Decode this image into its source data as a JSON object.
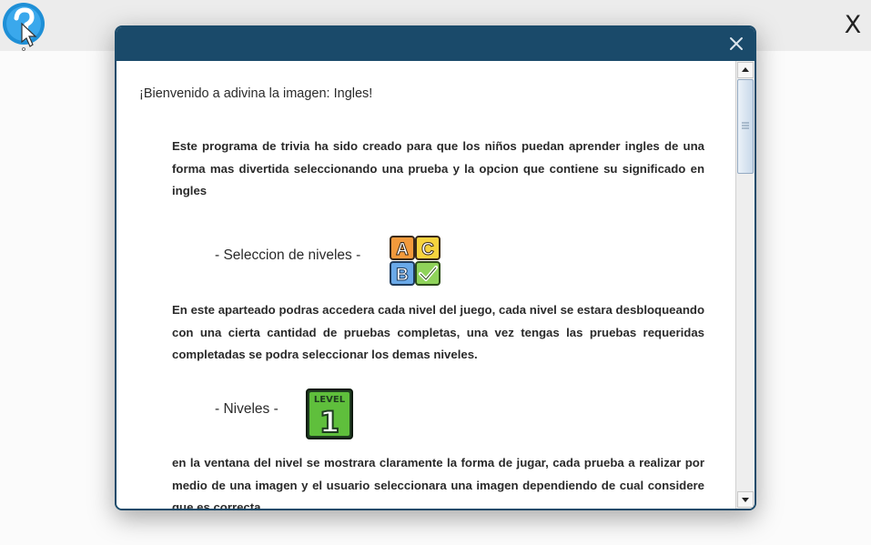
{
  "app": {
    "close_label": "X",
    "help_icon": "question-mark-cursor-icon"
  },
  "dialog": {
    "header_color": "#1a4a6a",
    "close_icon": "close-icon",
    "welcome_text": "¡Bienvenido a adivina la imagen: Ingles!",
    "intro_text": "Este programa de trivia ha sido creado para que los niños puedan aprender ingles de una forma mas divertida seleccionando una prueba y la opcion que contiene su significado en ingles",
    "sections": [
      {
        "label": "- Seleccion de niveles -",
        "icon": "abc-checkmark-icon",
        "icon_letters": [
          "A",
          "C",
          "B"
        ],
        "text": "En este aparteado podras accedera cada nivel del juego, cada nivel se estara desbloqueando con una cierta cantidad de pruebas completas, una vez tengas las pruebas requeridas completadas se podra seleccionar los demas niveles."
      },
      {
        "label": "- Niveles -",
        "icon": "level-1-icon",
        "icon_caption": "LEVEL",
        "icon_number": "1",
        "text": "en la ventana del nivel se mostrara claramente la forma de jugar, cada prueba a realizar por medio de una imagen y el usuario seleccionara una imagen dependiendo de cual considere que es correcta"
      }
    ]
  }
}
